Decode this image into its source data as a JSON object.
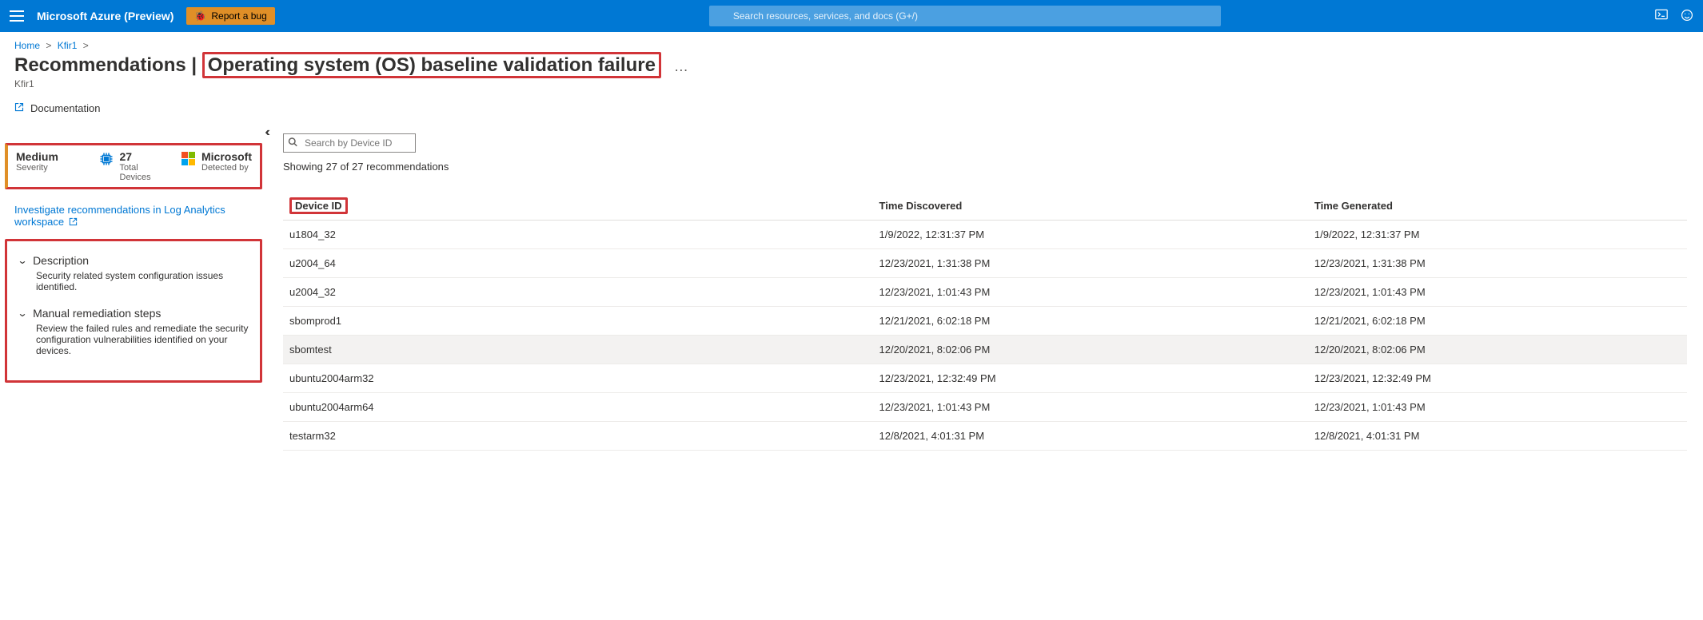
{
  "header": {
    "brand": "Microsoft Azure (Preview)",
    "report_bug": "Report a bug",
    "search_placeholder": "Search resources, services, and docs (G+/)"
  },
  "breadcrumb": {
    "home": "Home",
    "item": "Kfir1"
  },
  "title": {
    "prefix": "Recommendations | ",
    "highlight": "Operating system (OS) baseline validation failure",
    "subtitle": "Kfir1",
    "ellipsis": "…"
  },
  "doc_link": "Documentation",
  "metrics": {
    "severity": {
      "value": "Medium",
      "label": "Severity"
    },
    "devices": {
      "value": "27",
      "label": "Total Devices"
    },
    "detected": {
      "value": "Microsoft",
      "label": "Detected by"
    }
  },
  "investigate_link": "Investigate recommendations in Log Analytics workspace",
  "sections": {
    "description": {
      "title": "Description",
      "body": "Security related system configuration issues identified."
    },
    "remediation": {
      "title": "Manual remediation steps",
      "body": "Review the failed rules and remediate the security configuration vulnerabilities identified on your devices."
    }
  },
  "device_search_placeholder": "Search by Device ID",
  "showing": "Showing 27 of 27 recommendations",
  "table": {
    "headers": {
      "device": "Device ID",
      "discovered": "Time Discovered",
      "generated": "Time Generated"
    },
    "rows": [
      {
        "device": "u1804_32",
        "discovered": "1/9/2022, 12:31:37 PM",
        "generated": "1/9/2022, 12:31:37 PM"
      },
      {
        "device": "u2004_64",
        "discovered": "12/23/2021, 1:31:38 PM",
        "generated": "12/23/2021, 1:31:38 PM"
      },
      {
        "device": "u2004_32",
        "discovered": "12/23/2021, 1:01:43 PM",
        "generated": "12/23/2021, 1:01:43 PM"
      },
      {
        "device": "sbomprod1",
        "discovered": "12/21/2021, 6:02:18 PM",
        "generated": "12/21/2021, 6:02:18 PM"
      },
      {
        "device": "sbomtest",
        "discovered": "12/20/2021, 8:02:06 PM",
        "generated": "12/20/2021, 8:02:06 PM",
        "hovered": true
      },
      {
        "device": "ubuntu2004arm32",
        "discovered": "12/23/2021, 12:32:49 PM",
        "generated": "12/23/2021, 12:32:49 PM"
      },
      {
        "device": "ubuntu2004arm64",
        "discovered": "12/23/2021, 1:01:43 PM",
        "generated": "12/23/2021, 1:01:43 PM"
      },
      {
        "device": "testarm32",
        "discovered": "12/8/2021, 4:01:31 PM",
        "generated": "12/8/2021, 4:01:31 PM"
      }
    ]
  }
}
